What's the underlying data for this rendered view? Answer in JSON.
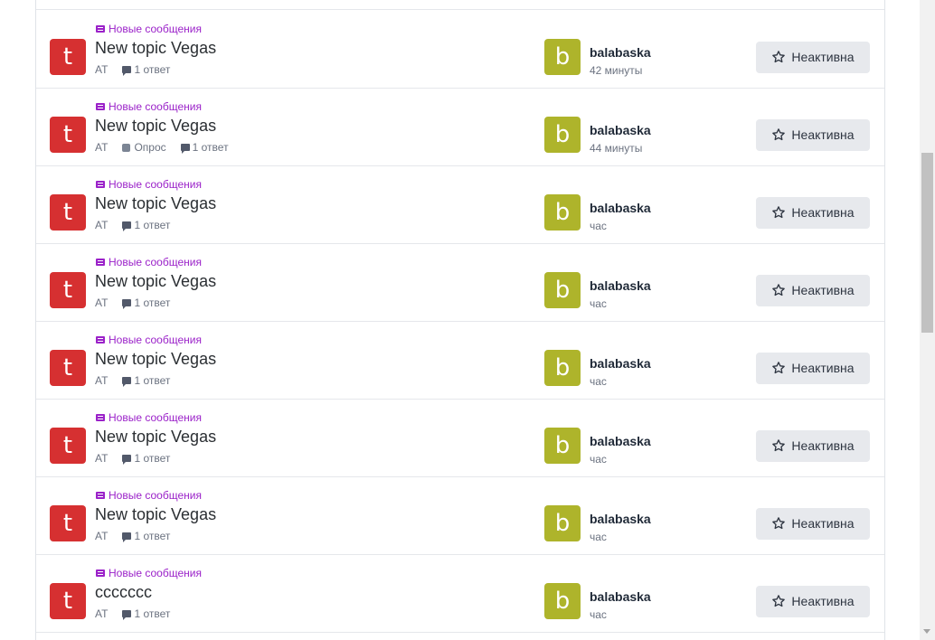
{
  "topics": [
    {
      "tag": "Новые сообщения",
      "title": "New topic Vegas",
      "author": "AT",
      "poll": "",
      "replies": "1 ответ",
      "avatar_letter": "t",
      "last_user": "balabaska",
      "last_user_avatar_letter": "b",
      "last_time": "42 минуты",
      "button": "Неактивна"
    },
    {
      "tag": "Новые сообщения",
      "title": "New topic Vegas",
      "author": "AT",
      "poll": "Опрос",
      "replies": "1 ответ",
      "avatar_letter": "t",
      "last_user": "balabaska",
      "last_user_avatar_letter": "b",
      "last_time": "44 минуты",
      "button": "Неактивна"
    },
    {
      "tag": "Новые сообщения",
      "title": "New topic Vegas",
      "author": "AT",
      "poll": "",
      "replies": "1 ответ",
      "avatar_letter": "t",
      "last_user": "balabaska",
      "last_user_avatar_letter": "b",
      "last_time": "час",
      "button": "Неактивна"
    },
    {
      "tag": "Новые сообщения",
      "title": "New topic Vegas",
      "author": "AT",
      "poll": "",
      "replies": "1 ответ",
      "avatar_letter": "t",
      "last_user": "balabaska",
      "last_user_avatar_letter": "b",
      "last_time": "час",
      "button": "Неактивна"
    },
    {
      "tag": "Новые сообщения",
      "title": "New topic Vegas",
      "author": "AT",
      "poll": "",
      "replies": "1 ответ",
      "avatar_letter": "t",
      "last_user": "balabaska",
      "last_user_avatar_letter": "b",
      "last_time": "час",
      "button": "Неактивна"
    },
    {
      "tag": "Новые сообщения",
      "title": "New topic Vegas",
      "author": "AT",
      "poll": "",
      "replies": "1 ответ",
      "avatar_letter": "t",
      "last_user": "balabaska",
      "last_user_avatar_letter": "b",
      "last_time": "час",
      "button": "Неактивна"
    },
    {
      "tag": "Новые сообщения",
      "title": "New topic Vegas",
      "author": "AT",
      "poll": "",
      "replies": "1 ответ",
      "avatar_letter": "t",
      "last_user": "balabaska",
      "last_user_avatar_letter": "b",
      "last_time": "час",
      "button": "Неактивна"
    },
    {
      "tag": "Новые сообщения",
      "title": "ccccccc",
      "author": "AT",
      "poll": "",
      "replies": "1 ответ",
      "avatar_letter": "t",
      "last_user": "balabaska",
      "last_user_avatar_letter": "b",
      "last_time": "час",
      "button": "Неактивна"
    }
  ],
  "icons": {
    "tag": "new-messages-icon",
    "poll": "poll-icon",
    "replies": "replies-icon",
    "button": "star-icon"
  },
  "colors": {
    "tag": "#9b22c9",
    "author_avatar": "#d63031",
    "user_avatar": "#aeb42b",
    "button_bg": "#e7e9ed"
  }
}
